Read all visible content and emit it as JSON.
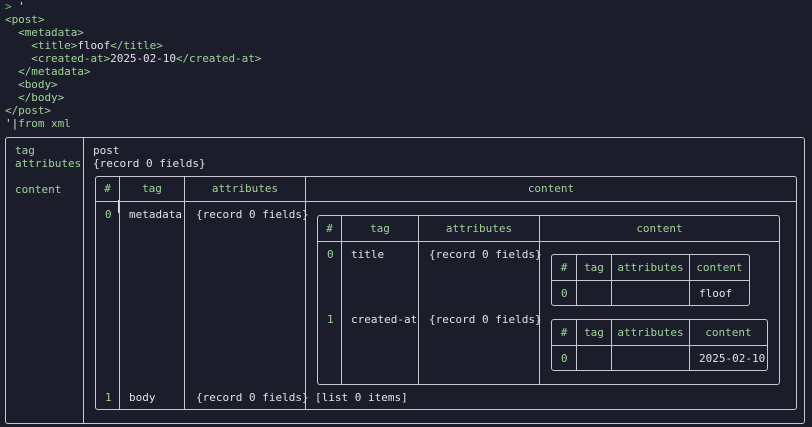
{
  "terminal": {
    "prompt_symbol": ">",
    "input_lines": [
      {
        "pre": " '",
        "tag": ""
      },
      {
        "pre": "",
        "tag": "<post>"
      },
      {
        "pre": "  ",
        "tag": "<metadata>"
      },
      {
        "pre": "    ",
        "tag": "<title>",
        "text": "floof",
        "close": "</title>"
      },
      {
        "pre": "    ",
        "tag": "<created-at>",
        "text": "2025-02-10",
        "close": "</created-at>"
      },
      {
        "pre": "  ",
        "tag": "</metadata>"
      },
      {
        "pre": "  ",
        "tag": "<body>"
      },
      {
        "pre": "  ",
        "tag": "</body>"
      },
      {
        "pre": "",
        "tag": "</post>"
      }
    ],
    "last_line_quote": "'",
    "pipe": "|",
    "command": "from xml"
  },
  "record": {
    "tag_key": "tag",
    "tag_value": "post",
    "attributes_key": "attributes",
    "attributes_value": "{record 0 fields}",
    "content_key": "content"
  },
  "outer_table": {
    "headers": [
      "#",
      "tag",
      "attributes",
      "content"
    ],
    "rows": [
      {
        "index": "0",
        "tag": "metadata",
        "attributes": "{record 0 fields}"
      },
      {
        "index": "1",
        "tag": "body",
        "attributes": "{record 0 fields}",
        "content": "[list 0 items]"
      }
    ]
  },
  "inner_table": {
    "headers": [
      "#",
      "tag",
      "attributes",
      "content"
    ],
    "rows": [
      {
        "index": "0",
        "tag": "title",
        "attributes": "{record 0 fields}"
      },
      {
        "index": "1",
        "tag": "created-at",
        "attributes": "{record 0 fields}"
      }
    ]
  },
  "leaf_tables": [
    {
      "headers": [
        "#",
        "tag",
        "attributes",
        "content"
      ],
      "index": "0",
      "tag": "",
      "attributes": "",
      "content": "floof"
    },
    {
      "headers": [
        "#",
        "tag",
        "attributes",
        "content"
      ],
      "index": "0",
      "tag": "",
      "attributes": "",
      "content": "2025-02-10"
    }
  ],
  "colors": {
    "background": "#1b1d2a",
    "accent_green": "#9fd49a",
    "prompt_green": "#6fbf6f",
    "text": "#e2e2e8",
    "border": "#c8c8d0"
  }
}
